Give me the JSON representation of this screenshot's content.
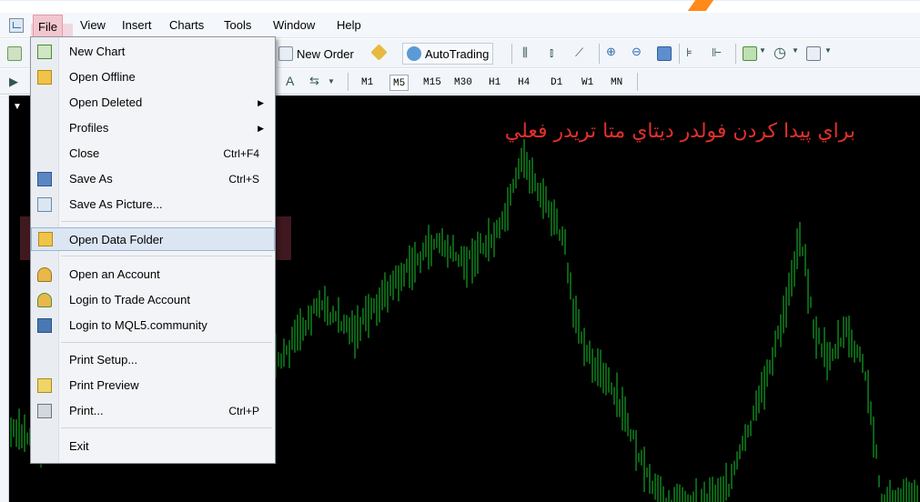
{
  "menubar": {
    "items": [
      "File",
      "View",
      "Insert",
      "Charts",
      "Tools",
      "Window",
      "Help"
    ]
  },
  "toolbar": {
    "new_order_label": "New Order",
    "autotrading_label": "AutoTrading",
    "text_tool_label": "A",
    "timeframes": [
      "M1",
      "M5",
      "M15",
      "M30",
      "H1",
      "H4",
      "D1",
      "W1",
      "MN"
    ],
    "active_timeframe": "M5"
  },
  "chart": {
    "overlay_text": "براي پيدا کردن فولدر ديتاي متا تريدر فعلي",
    "overlay_color": "#e0302a",
    "bar_color": "#16c32a",
    "background": "#000000"
  },
  "file_menu": {
    "items": [
      {
        "label": "New Chart",
        "icon": "new-chart-icon"
      },
      {
        "label": "Open Offline",
        "icon": "open-folder-icon"
      },
      {
        "label": "Open Deleted",
        "submenu": true
      },
      {
        "label": "Profiles",
        "submenu": true
      },
      {
        "label": "Close",
        "shortcut": "Ctrl+F4"
      },
      {
        "label": "Save As",
        "shortcut": "Ctrl+S",
        "icon": "save-icon"
      },
      {
        "label": "Save As Picture...",
        "icon": "save-picture-icon"
      },
      {
        "label": "Open Data Folder",
        "icon": "data-folder-icon",
        "highlighted": true
      },
      {
        "label": "Open an Account",
        "icon": "open-account-icon"
      },
      {
        "label": "Login to Trade Account",
        "icon": "login-icon"
      },
      {
        "label": "Login to MQL5.community",
        "icon": "mql5-icon"
      },
      {
        "label": "Print Setup..."
      },
      {
        "label": "Print Preview",
        "icon": "print-preview-icon"
      },
      {
        "label": "Print...",
        "shortcut": "Ctrl+P",
        "icon": "printer-icon"
      },
      {
        "label": "Exit"
      }
    ]
  }
}
